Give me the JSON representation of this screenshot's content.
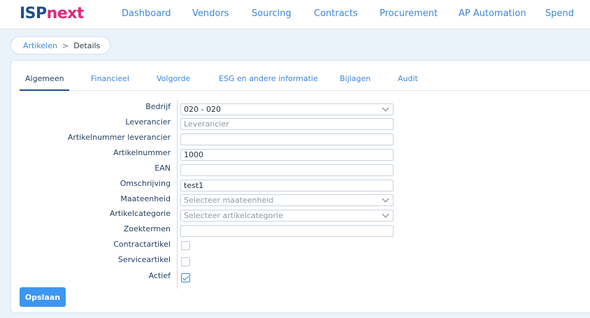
{
  "brand": {
    "part1": "ISP",
    "part2": "next"
  },
  "nav": [
    "Dashboard",
    "Vendors",
    "Sourcing",
    "Contracts",
    "Procurement",
    "AP Automation",
    "Spend"
  ],
  "breadcrumb": {
    "parent": "Artikelen",
    "separator": ">",
    "current": "Details"
  },
  "tabs": [
    "Algemeen",
    "Financieel",
    "Volgorde",
    "ESG en andere informatie",
    "Bijlagen",
    "Audit"
  ],
  "active_tab": "Algemeen",
  "form": {
    "bedrijf": {
      "label": "Bedrijf",
      "value": "020 - 020"
    },
    "leverancier": {
      "label": "Leverancier",
      "placeholder": "Leverancier"
    },
    "artikelnummer_leverancier": {
      "label": "Artikelnummer leverancier",
      "value": ""
    },
    "artikelnummer": {
      "label": "Artikelnummer",
      "value": "1000"
    },
    "ean": {
      "label": "EAN",
      "value": ""
    },
    "omschrijving": {
      "label": "Omschrijving",
      "value": "test1"
    },
    "maateenheid": {
      "label": "Maateenheid",
      "placeholder": "Selecteer maateenheid"
    },
    "artikelcategorie": {
      "label": "Artikelcategorie",
      "placeholder": "Selecteer artikelcategorie"
    },
    "zoektermen": {
      "label": "Zoektermen",
      "value": ""
    },
    "contractartikel": {
      "label": "Contractartikel",
      "checked": false
    },
    "serviceartikel": {
      "label": "Serviceartikel",
      "checked": false
    },
    "actief": {
      "label": "Actief",
      "checked": true
    }
  },
  "actions": {
    "save_label": "Opslaan"
  },
  "colors": {
    "accent": "#3d86d8",
    "brand_blue": "#1f4f8a",
    "brand_pink": "#e0287d",
    "button": "#3d96f0"
  }
}
